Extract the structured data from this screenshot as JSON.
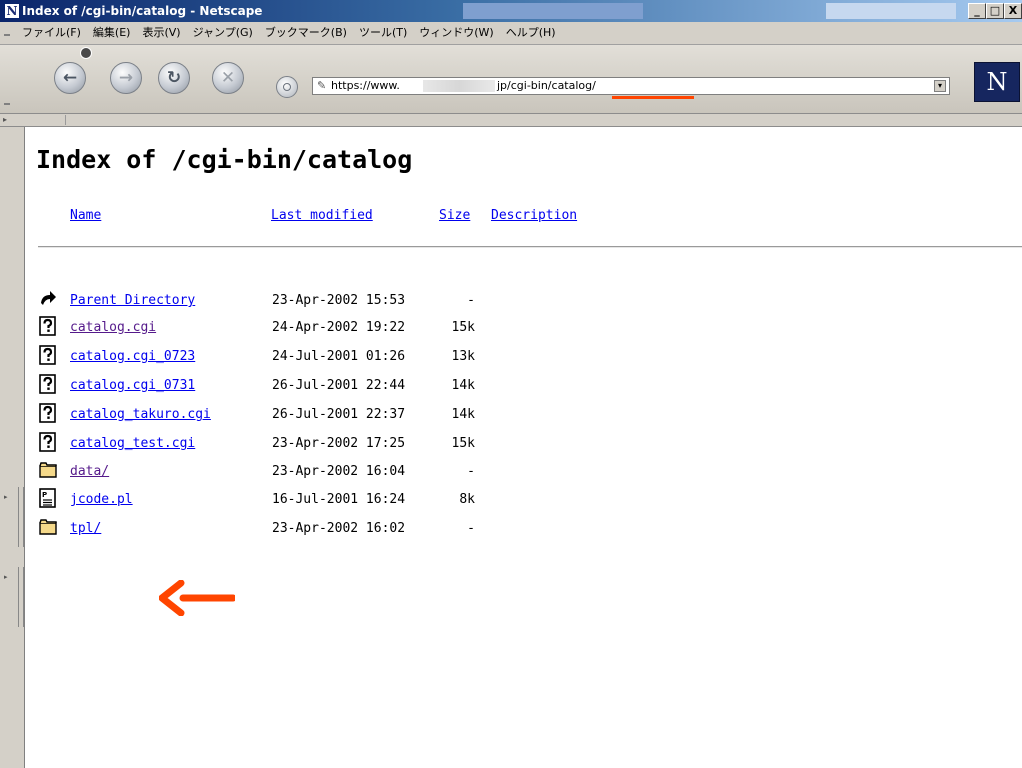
{
  "window": {
    "title": "Index of /cgi-bin/catalog - Netscape",
    "logo_letter": "N",
    "buttons": {
      "minimize": "_",
      "maximize": "□",
      "close": "X"
    }
  },
  "menu": [
    "ファイル(F)",
    "編集(E)",
    "表示(V)",
    "ジャンプ(G)",
    "ブックマーク(B)",
    "ツール(T)",
    "ウィンドウ(W)",
    "ヘルプ(H)"
  ],
  "toolbar": {
    "back": "←",
    "forward": "→",
    "reload": "↻",
    "stop": "✕",
    "url_part1": "https://www.",
    "url_part2": "jp/cgi-bin/catalog/",
    "dropdown": "▾",
    "brand_letter": "N"
  },
  "page": {
    "title": "Index of /cgi-bin/catalog",
    "headers": {
      "name": "Name",
      "modified": "Last modified",
      "size": "Size",
      "description": "Description"
    },
    "rows": [
      {
        "icon": "parent-directory-icon",
        "name": "Parent Directory",
        "date": "23-Apr-2002 15:53",
        "size": "-",
        "visited": false
      },
      {
        "icon": "unknown-file-icon",
        "name": "catalog.cgi",
        "date": "24-Apr-2002 19:22",
        "size": "15k",
        "visited": true
      },
      {
        "icon": "unknown-file-icon",
        "name": "catalog.cgi_0723",
        "date": "24-Jul-2001 01:26",
        "size": "13k",
        "visited": false
      },
      {
        "icon": "unknown-file-icon",
        "name": "catalog.cgi_0731",
        "date": "26-Jul-2001 22:44",
        "size": "14k",
        "visited": false
      },
      {
        "icon": "unknown-file-icon",
        "name": "catalog_takuro.cgi",
        "date": "26-Jul-2001 22:37",
        "size": "14k",
        "visited": false
      },
      {
        "icon": "unknown-file-icon",
        "name": "catalog_test.cgi",
        "date": "23-Apr-2002 17:25",
        "size": "15k",
        "visited": false
      },
      {
        "icon": "folder-icon",
        "name": "data/",
        "date": "23-Apr-2002 16:04",
        "size": "-",
        "visited": true
      },
      {
        "icon": "text-file-icon",
        "name": "jcode.pl",
        "date": "16-Jul-2001 16:24",
        "size": "8k",
        "visited": false
      },
      {
        "icon": "folder-icon",
        "name": "tpl/",
        "date": "23-Apr-2002 16:02",
        "size": "-",
        "visited": false
      }
    ]
  },
  "colors": {
    "link": "#0000ee",
    "visited": "#551a8b",
    "annotation": "#ff4500",
    "title_bar": "#0a246a",
    "chrome": "#d4d0c8"
  }
}
